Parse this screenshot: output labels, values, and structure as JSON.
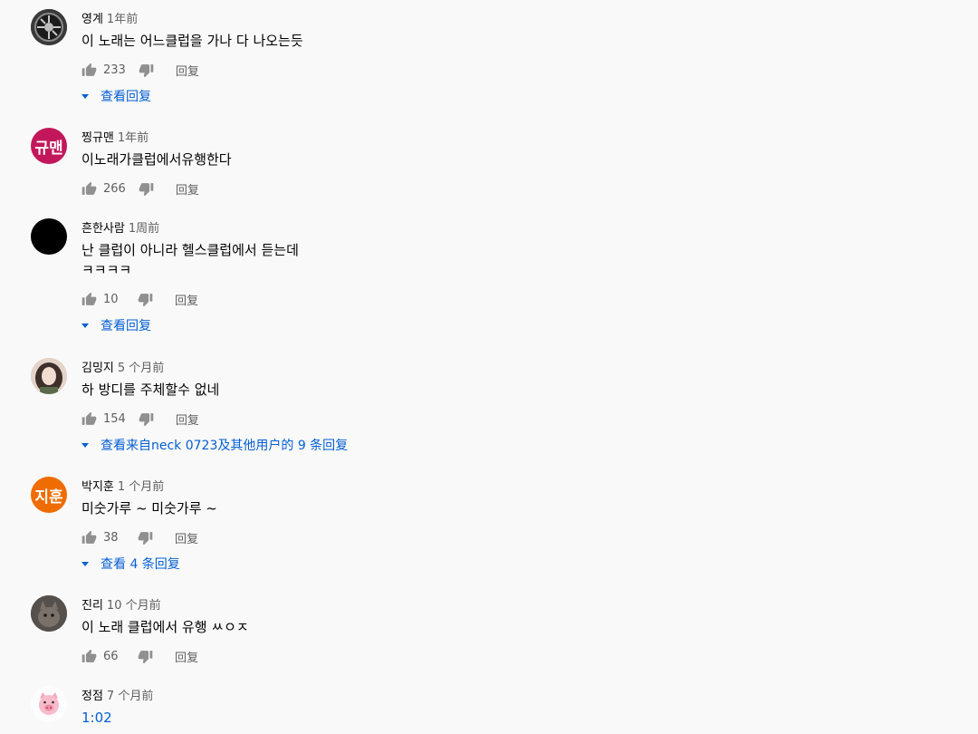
{
  "comments": [
    {
      "author": "영계",
      "time": "1年前",
      "text": [
        "이 노래는 어느클럽을 가나 다 나오는듯"
      ],
      "likes": "233",
      "reply": "回复",
      "view_replies": "查看回复",
      "avatar": "photo-dark"
    },
    {
      "author": "찡규맨",
      "time": "1年前",
      "text": [
        "이노래가클럽에서유행한다"
      ],
      "likes": "266",
      "reply": "回复",
      "view_replies": "",
      "avatar": "letter",
      "avatar_text": "규맨",
      "avatar_color": "#c2185b"
    },
    {
      "author": "흔한사람",
      "time": "1周前",
      "text": [
        "난 클럽이 아니라 헬스클럽에서 듣는데",
        "ㅋㅋㅋㅋ"
      ],
      "likes": "10",
      "reply": "回复",
      "view_replies": "查看回复",
      "avatar": "black"
    },
    {
      "author": "김밍지",
      "time": "5 个月前",
      "text": [
        "하 방디를 주체할수 없네"
      ],
      "likes": "154",
      "reply": "回复",
      "view_replies": "查看来自neck 0723及其他用户的 9 条回复",
      "avatar": "photo-girl"
    },
    {
      "author": "박지훈",
      "time": "1 个月前",
      "text": [
        "미숫가루 ~ 미숫가루 ~"
      ],
      "likes": "38",
      "reply": "回复",
      "view_replies": "查看 4 条回复",
      "avatar": "letter",
      "avatar_text": "지훈",
      "avatar_color": "#ef6c00"
    },
    {
      "author": "진리",
      "time": "10 个月前",
      "text": [
        "이 노래 클럽에서 유행 ㅆㅇㅈ"
      ],
      "likes": "66",
      "reply": "回复",
      "view_replies": "",
      "avatar": "photo-cat"
    },
    {
      "author": "정점",
      "time": "7 个月前",
      "text": [
        "1:02"
      ],
      "likes": "",
      "reply": "",
      "view_replies": "",
      "avatar": "pig"
    }
  ]
}
